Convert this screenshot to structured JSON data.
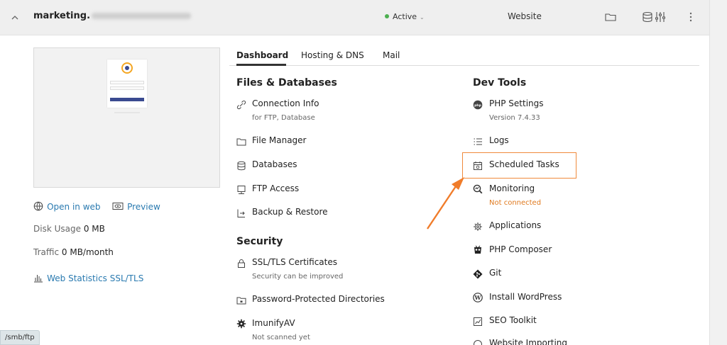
{
  "header": {
    "domain": "marketing.",
    "status": "Active",
    "type_label": "Website"
  },
  "left": {
    "open_in_web": "Open in web",
    "preview": "Preview",
    "disk_usage_label": "Disk Usage",
    "disk_usage_value": "0 MB",
    "traffic_label": "Traffic",
    "traffic_value": "0 MB/month",
    "web_statistics": "Web Statistics SSL/TLS"
  },
  "tabs": [
    {
      "label": "Dashboard"
    },
    {
      "label": "Hosting & DNS"
    },
    {
      "label": "Mail"
    }
  ],
  "files_databases": {
    "title": "Files & Databases",
    "items": [
      {
        "label": "Connection Info",
        "sub": "for FTP, Database",
        "icon": "link-icon"
      },
      {
        "label": "File Manager",
        "icon": "folder-icon"
      },
      {
        "label": "Databases",
        "icon": "database-icon"
      },
      {
        "label": "FTP Access",
        "icon": "ftp-icon"
      },
      {
        "label": "Backup & Restore",
        "icon": "backup-icon"
      }
    ]
  },
  "security": {
    "title": "Security",
    "items": [
      {
        "label": "SSL/TLS Certificates",
        "sub": "Security can be improved",
        "icon": "certificate-icon"
      },
      {
        "label": "Password-Protected Directories",
        "icon": "locked-folder-icon"
      },
      {
        "label": "ImunifyAV",
        "sub": "Not scanned yet",
        "icon": "gear-icon"
      }
    ]
  },
  "dev_tools": {
    "title": "Dev Tools",
    "items": [
      {
        "label": "PHP Settings",
        "sub": "Version 7.4.33",
        "icon": "php-icon"
      },
      {
        "label": "Logs",
        "icon": "list-icon"
      },
      {
        "label": "Scheduled Tasks",
        "icon": "calendar-icon"
      },
      {
        "label": "Monitoring",
        "sub": "Not connected",
        "icon": "monitoring-icon"
      },
      {
        "label": "Applications",
        "icon": "gear-icon"
      },
      {
        "label": "PHP Composer",
        "icon": "composer-icon"
      },
      {
        "label": "Git",
        "icon": "git-icon"
      },
      {
        "label": "Install WordPress",
        "icon": "wordpress-icon"
      },
      {
        "label": "SEO Toolkit",
        "icon": "chart-icon"
      },
      {
        "label": "Website Importing",
        "icon": "import-icon"
      }
    ]
  },
  "status_bar": {
    "url": "/smb/ftp"
  },
  "colors": {
    "link": "#2a7ab0",
    "active_dot": "#4caf50",
    "highlight": "#f08a3c",
    "warning_text": "#e07a1f"
  }
}
